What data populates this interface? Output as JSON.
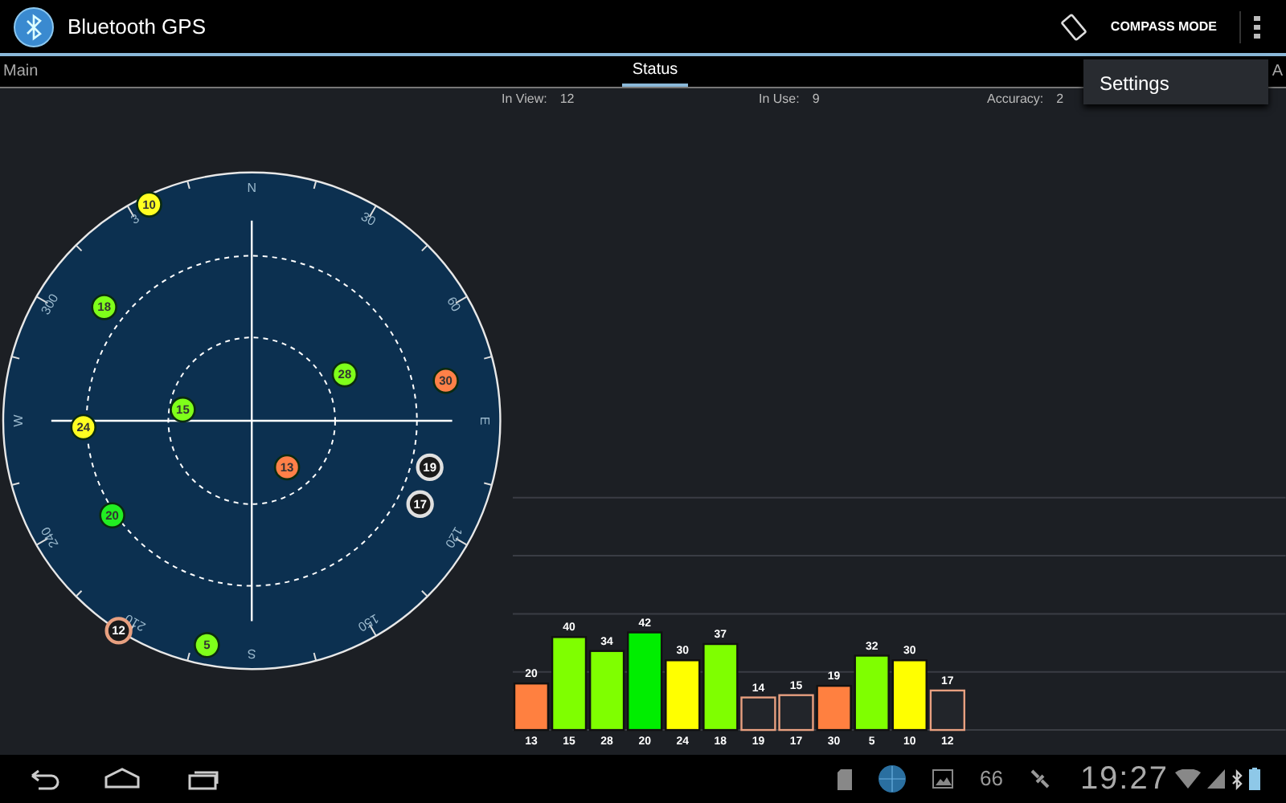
{
  "action_bar": {
    "title": "Bluetooth GPS",
    "compass_button": "COMPASS MODE"
  },
  "tabs": [
    {
      "label": "Main",
      "selected": false
    },
    {
      "label": "Status",
      "selected": true
    },
    {
      "label": "A",
      "selected": false
    }
  ],
  "info": [
    {
      "label": "In View:",
      "value": "12"
    },
    {
      "label": "In Use:",
      "value": "9"
    },
    {
      "label": "Accuracy:",
      "value": "2"
    }
  ],
  "overflow_menu": {
    "items": [
      "Settings"
    ]
  },
  "sky_plot": {
    "compass_labels": [
      "N",
      "30",
      "60",
      "E",
      "120",
      "150",
      "S",
      "210",
      "240",
      "W",
      "300",
      "3"
    ],
    "satellites": [
      {
        "prn": "10",
        "color": "#ffff22",
        "in_use": true
      },
      {
        "prn": "18",
        "color": "#7fff1a",
        "in_use": true
      },
      {
        "prn": "28",
        "color": "#7fff1a",
        "in_use": true
      },
      {
        "prn": "30",
        "color": "#ff8048",
        "in_use": true
      },
      {
        "prn": "15",
        "color": "#7fff1a",
        "in_use": true
      },
      {
        "prn": "24",
        "color": "#ffff22",
        "in_use": true
      },
      {
        "prn": "13",
        "color": "#ff8048",
        "in_use": true
      },
      {
        "prn": "19",
        "color": "#e0e0e0",
        "in_use": false
      },
      {
        "prn": "17",
        "color": "#e0e0e0",
        "in_use": false
      },
      {
        "prn": "20",
        "color": "#22ee22",
        "in_use": true
      },
      {
        "prn": "5",
        "color": "#7fff1a",
        "in_use": true
      },
      {
        "prn": "12",
        "color": "#e8a080",
        "in_use": false
      }
    ]
  },
  "signal_chart": {
    "chart_data": {
      "type": "bar",
      "categories": [
        "13",
        "15",
        "28",
        "20",
        "24",
        "18",
        "19",
        "17",
        "30",
        "5",
        "10",
        "12"
      ],
      "series": [
        {
          "values": [
            20,
            40,
            34,
            42,
            30,
            37,
            14,
            15,
            19,
            32,
            30,
            17
          ]
        }
      ],
      "ylim": [
        0,
        100
      ],
      "data_labels": true
    },
    "bars": [
      {
        "color": "#ff8040",
        "in_use": true
      },
      {
        "color": "#7fff00",
        "in_use": true
      },
      {
        "color": "#7fff00",
        "in_use": true
      },
      {
        "color": "#00ee00",
        "in_use": true
      },
      {
        "color": "#ffff00",
        "in_use": true
      },
      {
        "color": "#7fff00",
        "in_use": true
      },
      {
        "color": "#e8a080",
        "in_use": false
      },
      {
        "color": "#e8a080",
        "in_use": false
      },
      {
        "color": "#ff8040",
        "in_use": true
      },
      {
        "color": "#7fff00",
        "in_use": true
      },
      {
        "color": "#ffff00",
        "in_use": true
      },
      {
        "color": "#e8a080",
        "in_use": false
      }
    ]
  },
  "status_bar": {
    "battery_text": "66",
    "time": "19:27"
  }
}
